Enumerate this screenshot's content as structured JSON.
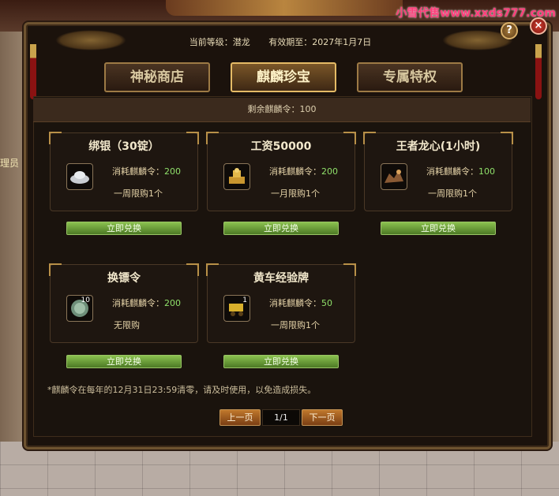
{
  "watermark": "小雪代售www.xxds777.com",
  "side_text": "理员",
  "header": {
    "level_label": "当前等级：潜龙",
    "expire_label": "有效期至：2027年1月7日"
  },
  "tabs": [
    {
      "label": "神秘商店",
      "active": false
    },
    {
      "label": "麒麟珍宝",
      "active": true
    },
    {
      "label": "专属特权",
      "active": false
    }
  ],
  "remaining": "剩余麒麟令：100",
  "cost_prefix": "消耗麒麟令：",
  "items": [
    {
      "title": "绑银（30锭）",
      "cost": "200",
      "limit": "一周限购1个",
      "icon": "silver-ingot-icon",
      "count": ""
    },
    {
      "title": "工资50000",
      "cost": "200",
      "limit": "一月限购1个",
      "icon": "gold-seal-icon",
      "count": ""
    },
    {
      "title": "王者龙心(1小时)",
      "cost": "100",
      "limit": "一周限购1个",
      "icon": "dragon-heart-icon",
      "count": ""
    },
    {
      "title": "换镖令",
      "cost": "200",
      "limit": "无限购",
      "icon": "escort-token-icon",
      "count": "10"
    },
    {
      "title": "黄车经验牌",
      "cost": "50",
      "limit": "一周限购1个",
      "icon": "yellow-cart-icon",
      "count": "1"
    }
  ],
  "exchange_label": "立即兑换",
  "note": "*麒麟令在每年的12月31日23:59清零，请及时使用，以免造成损失。",
  "pager": {
    "prev": "上一页",
    "info": "1/1",
    "next": "下一页"
  },
  "help_label": "?",
  "close_label": "×",
  "colors": {
    "accent_gold": "#e5bb66",
    "cost_green": "#8fe06a",
    "button_green": "#6aa03a",
    "button_orange": "#a8561f"
  }
}
